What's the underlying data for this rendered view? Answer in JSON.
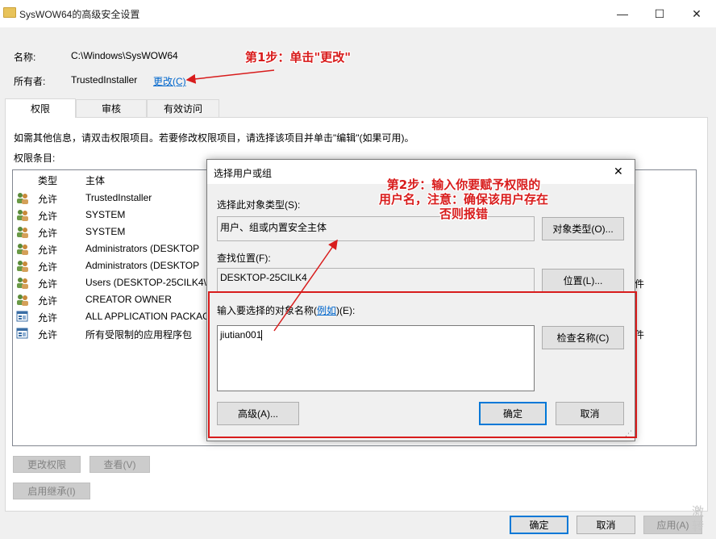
{
  "window": {
    "title": "SysWOW64的高级安全设置",
    "minimize_glyph": "—",
    "maximize_glyph": "☐",
    "close_glyph": "✕"
  },
  "info": {
    "name_label": "名称:",
    "name_value": "C:\\Windows\\SysWOW64",
    "owner_label": "所有者:",
    "owner_value": "TrustedInstaller",
    "change_link": "更改(C)"
  },
  "tabs": [
    "权限",
    "审核",
    "有效访问"
  ],
  "hint_text": "如需其他信息，请双击权限项目。若要修改权限项目，请选择该项目并单击\"编辑\"(如果可用)。",
  "entries_label": "权限条目:",
  "columns": {
    "type": "类型",
    "principal": "主体"
  },
  "entries": [
    {
      "type": "允许",
      "principal": "TrustedInstaller",
      "icon": "users-icon",
      "extra": ""
    },
    {
      "type": "允许",
      "principal": "SYSTEM",
      "icon": "users-icon",
      "extra": ""
    },
    {
      "type": "允许",
      "principal": "SYSTEM",
      "icon": "users-icon",
      "extra": ""
    },
    {
      "type": "允许",
      "principal": "Administrators (DESKTOP",
      "icon": "users-icon",
      "extra": ""
    },
    {
      "type": "允许",
      "principal": "Administrators (DESKTOP",
      "icon": "users-icon",
      "extra": ""
    },
    {
      "type": "允许",
      "principal": "Users (DESKTOP-25CILK4\\",
      "icon": "users-icon",
      "extra": "件"
    },
    {
      "type": "允许",
      "principal": "CREATOR OWNER",
      "icon": "users-icon",
      "extra": ""
    },
    {
      "type": "允许",
      "principal": "ALL APPLICATION PACKAG",
      "icon": "app-package-icon",
      "extra": ""
    },
    {
      "type": "允许",
      "principal": "所有受限制的应用程序包",
      "icon": "app-package-icon",
      "extra": "件"
    }
  ],
  "buttons": {
    "change_permissions": "更改权限",
    "view": "查看(V)",
    "enable_inheritance": "启用继承(I)",
    "ok": "确定",
    "cancel": "取消",
    "apply": "应用(A)"
  },
  "dialog": {
    "title": "选择用户或组",
    "close_glyph": "✕",
    "object_type_label": "选择此对象类型(S):",
    "object_type_value": "用户、组或内置安全主体",
    "object_types_button": "对象类型(O)...",
    "location_label": "查找位置(F):",
    "location_value": "DESKTOP-25CILK4",
    "locations_button": "位置(L)...",
    "names_label_prefix": "输入要选择的对象名称(",
    "names_label_link": "例如",
    "names_label_suffix": ")(E):",
    "names_value": "jiutian001",
    "check_names_button": "检查名称(C)",
    "advanced_button": "高级(A)...",
    "ok_button": "确定",
    "cancel_button": "取消"
  },
  "annotations": {
    "step1": "第1步：单击\"更改\"",
    "step2_line1": "第2步：输入你要赋予权限的",
    "step2_line2": "用户名，注意：确保该用户存在",
    "step2_line3": "否则报错"
  },
  "watermark": {
    "line1": "激",
    "line2": "转"
  },
  "colors": {
    "accent": "#0078d7",
    "annotation_red": "#d81c1c",
    "link_blue": "#0066cc"
  }
}
